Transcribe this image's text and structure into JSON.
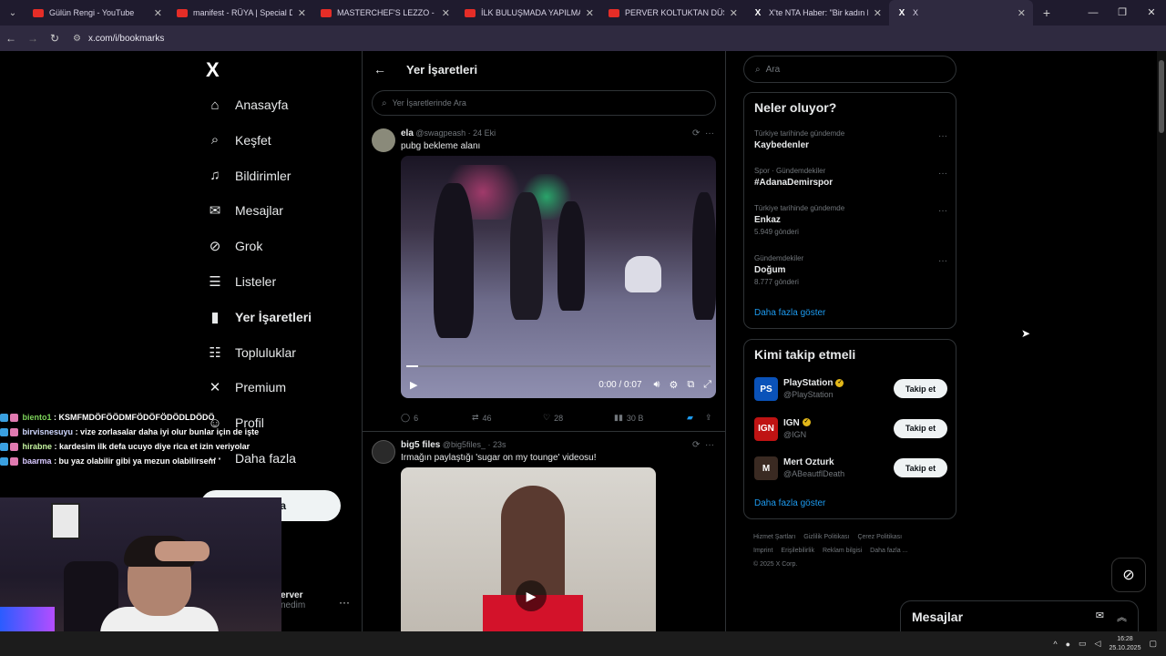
{
  "browser": {
    "tabs": [
      {
        "title": "Gülün Rengi - YouTube",
        "icon": "youtube-icon"
      },
      {
        "title": "manifest - RÜYA | Special Danc",
        "icon": "youtube-icon"
      },
      {
        "title": "MASTERCHEF'S LEZZO - YouTu",
        "icon": "youtube-icon"
      },
      {
        "title": "İLK BULUŞMADA YAPILMAMAS",
        "icon": "youtube-icon"
      },
      {
        "title": "PERVER KOLTUKTAN DÜŞÜYOR",
        "icon": "youtube-icon"
      },
      {
        "title": "X'te NTA Haber: \"Bir kadın kap",
        "icon": "x-icon"
      },
      {
        "title": "X",
        "icon": "x-icon"
      }
    ],
    "url": "x.com/i/bookmarks",
    "profile_initial": "P"
  },
  "nav": {
    "logo": "X",
    "items": [
      {
        "label": "Anasayfa",
        "icon": "home-icon"
      },
      {
        "label": "Keşfet",
        "icon": "search-icon"
      },
      {
        "label": "Bildirimler",
        "icon": "bell-icon"
      },
      {
        "label": "Mesajlar",
        "icon": "mail-icon"
      },
      {
        "label": "Grok",
        "icon": "grok-icon"
      },
      {
        "label": "Listeler",
        "icon": "list-icon"
      },
      {
        "label": "Yer İşaretleri",
        "icon": "bookmark-icon"
      },
      {
        "label": "Topluluklar",
        "icon": "community-icon"
      },
      {
        "label": "Premium",
        "icon": "x-premium-icon"
      },
      {
        "label": "Profil",
        "icon": "profile-icon"
      },
      {
        "label": "Daha fazla",
        "icon": "more-icon"
      }
    ],
    "post_button": "ayınla",
    "user_name": "erver",
    "user_handle": "nedim"
  },
  "main": {
    "title": "Yer İşaretleri",
    "search_placeholder": "Yer İşaretlerinde Ara",
    "tweets": [
      {
        "name": "ela",
        "handle": "@swagpeash",
        "time": "24 Eki",
        "text": "pubg bekleme alanı",
        "video_time": "0:00 / 0:07",
        "replies": "6",
        "retweets": "46",
        "likes": "28",
        "views": "30 B"
      },
      {
        "name": "big5 files",
        "handle": "@big5files_",
        "time": "23s",
        "text": "Irmağın paylaştığı 'sugar on my tounge' videosu!"
      }
    ]
  },
  "right": {
    "search_placeholder": "Ara",
    "trends_title": "Neler oluyor?",
    "trends": [
      {
        "category": "Türkiye tarihinde gündemde",
        "name": "Kaybedenler",
        "count": ""
      },
      {
        "category": "Spor · Gündemdekiler",
        "name": "#AdanaDemirspor",
        "count": ""
      },
      {
        "category": "Türkiye tarihinde gündemde",
        "name": "Enkaz",
        "count": "5.949 gönderi"
      },
      {
        "category": "Gündemdekiler",
        "name": "Doğum",
        "count": "8.777 gönderi"
      }
    ],
    "show_more": "Daha fazla göster",
    "follow_title": "Kimi takip etmeli",
    "follow": [
      {
        "name": "PlayStation",
        "handle": "@PlayStation",
        "verified": true,
        "color": "#0a52b9",
        "initials": "PS"
      },
      {
        "name": "IGN",
        "handle": "@IGN",
        "verified": true,
        "color": "#bf1313",
        "initials": "IGN"
      },
      {
        "name": "Mert Ozturk",
        "handle": "@ABeautflDeath",
        "verified": false,
        "color": "#3a2a22",
        "initials": "M"
      }
    ],
    "follow_button": "Takip et",
    "footer": [
      "Hizmet Şartları",
      "Gizlilik Politikası",
      "Çerez Politikası",
      "Imprint",
      "Erişilebilirlik",
      "Reklam bilgisi",
      "Daha fazla ...",
      "© 2025 X Corp."
    ]
  },
  "messages_panel": {
    "title": "Mesajlar"
  },
  "stream_chat": [
    {
      "user": "biento1",
      "message": ": KSMFMDÖFÖÖDMFÖDÖFÖDÖDLDÖDÖ"
    },
    {
      "user": "birvisnesuyu",
      "message": ": vize zorlasalar daha iyi olur bunlar için de işte"
    },
    {
      "user": "hirabne",
      "message": ": kardesim ilk defa ucuyo diye rica et izin veriyolar"
    },
    {
      "user": "baarma",
      "message": ": bu yaz olabilir gibi ya mezun olabilirsem"
    }
  ],
  "taskbar": {
    "time": "16:28",
    "date": "25.10.2025"
  }
}
